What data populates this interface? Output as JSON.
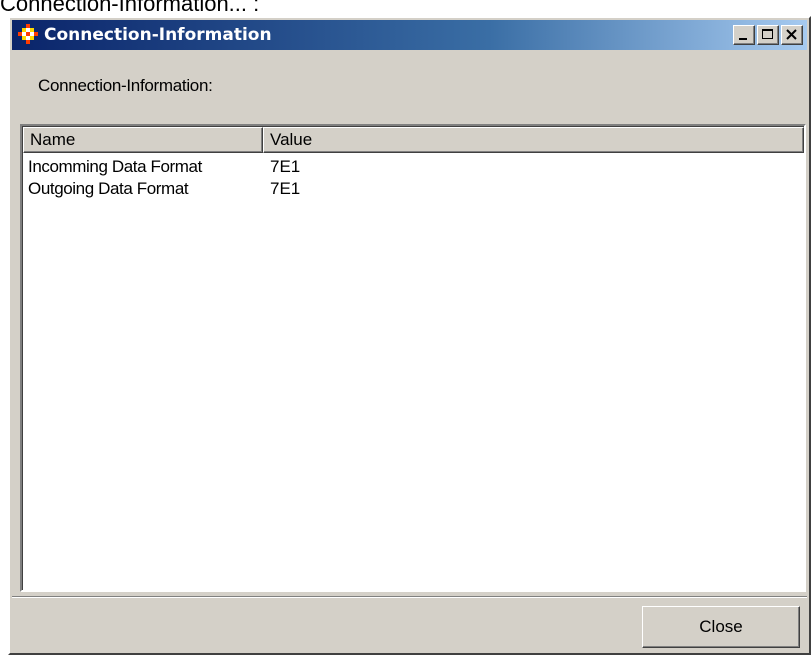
{
  "caption": "Connection-Information... :",
  "window": {
    "title": "Connection-Information",
    "icon": "app-diamond-icon",
    "controls": {
      "minimize_icon": "minimize-icon",
      "maximize_icon": "maximize-icon",
      "close_icon": "close-icon"
    }
  },
  "main": {
    "label": "Connection-Information:",
    "list": {
      "columns": [
        "Name",
        "Value"
      ],
      "rows": [
        {
          "name": "Incomming Data Format",
          "value": "7E1"
        },
        {
          "name": "Outgoing Data Format",
          "value": "7E1"
        }
      ]
    }
  },
  "footer": {
    "close_label": "Close"
  },
  "colors": {
    "face": "#d4d0c8",
    "title_start": "#0a246a",
    "title_end": "#a6caf0"
  }
}
